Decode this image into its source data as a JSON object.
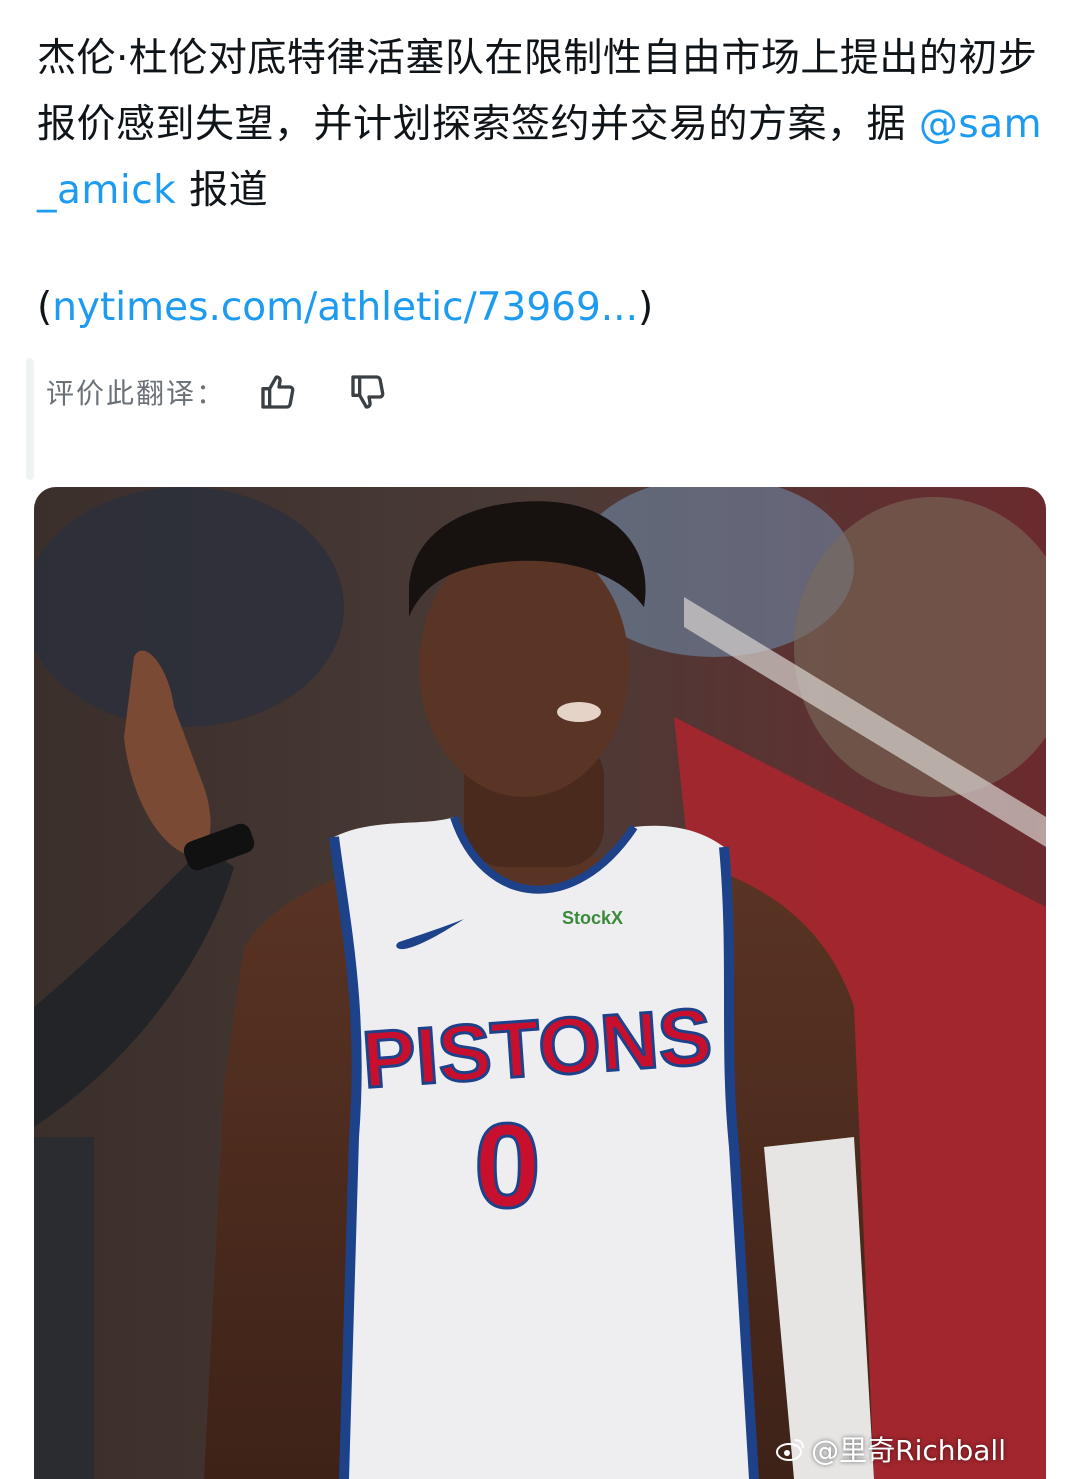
{
  "tweet": {
    "text_main": "杰伦·杜伦对底特律活塞队在限制性自由市场上提出的初步报价感到失望，并计划探索签约并交易的方案，据 ",
    "mention": "@sam_amick",
    "text_after": " 报道",
    "url_open": "(",
    "url": "nytimes.com/athletic/73969...",
    "url_close": ")"
  },
  "rating": {
    "label": "评价此翻译：",
    "thumbs_up_icon": "thumbs-up-icon",
    "thumbs_down_icon": "thumbs-down-icon"
  },
  "media": {
    "jersey_sponsor": "StockX",
    "jersey_team": "PISTONS",
    "jersey_number": "0",
    "watermark": "@里奇Richball",
    "watermark_icon": "weibo-icon"
  }
}
